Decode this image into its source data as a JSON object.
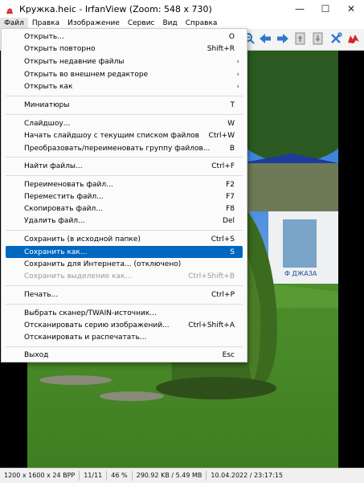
{
  "window": {
    "title": "Кружка.heic - IrfanView (Zoom: 548 x 730)",
    "minimize_glyph": "—",
    "maximize_glyph": "☐",
    "close_glyph": "✕"
  },
  "menubar": [
    "Файл",
    "Правка",
    "Изображение",
    "Сервис",
    "Вид",
    "Справка"
  ],
  "file_menu": {
    "items": [
      {
        "label": "Открыть...",
        "shortcut": "O"
      },
      {
        "label": "Открыть повторно",
        "shortcut": "Shift+R"
      },
      {
        "label": "Открыть недавние файлы",
        "submenu": true
      },
      {
        "label": "Открыть во внешнем редакторе",
        "submenu": true
      },
      {
        "label": "Открыть как",
        "submenu": true
      },
      {
        "label": "Миниатюры",
        "shortcut": "T"
      },
      {
        "label": "Слайдшоу...",
        "shortcut": "W"
      },
      {
        "label": "Начать слайдшоу с текущим списком файлов",
        "shortcut": "Ctrl+W"
      },
      {
        "label": "Преобразовать/переименовать группу файлов...",
        "shortcut": "B"
      },
      {
        "label": "Найти файлы...",
        "shortcut": "Ctrl+F"
      },
      {
        "label": "Переименовать файл...",
        "shortcut": "F2"
      },
      {
        "label": "Переместить файл...",
        "shortcut": "F7"
      },
      {
        "label": "Скопировать файл...",
        "shortcut": "F8"
      },
      {
        "label": "Удалить файл...",
        "shortcut": "Del"
      },
      {
        "label": "Сохранить (в исходной папке)",
        "shortcut": "Ctrl+S"
      },
      {
        "label": "Сохранить как...",
        "shortcut": "S",
        "selected": true
      },
      {
        "label": "Сохранить для Интернета... (отключено)"
      },
      {
        "label": "Сохранить выделение как...",
        "shortcut": "Ctrl+Shift+B",
        "disabled": true
      },
      {
        "label": "Печать...",
        "shortcut": "Ctrl+P"
      },
      {
        "label": "Выбрать сканер/TWAIN-источник..."
      },
      {
        "label": "Отсканировать серию изображений...",
        "shortcut": "Ctrl+Shift+A"
      },
      {
        "label": "Отсканировать и распечатать..."
      },
      {
        "label": "Выход",
        "shortcut": "Esc"
      }
    ]
  },
  "photo": {
    "sign_text": "Ф ДЖАЗА"
  },
  "statusbar": [
    "1200 x 1600 x 24 BPP",
    "11/11",
    "46 %",
    "290.92 KB / 5.49 MB",
    "10.04.2022 / 23:17:15"
  ],
  "colors": {
    "menu_highlight": "#0067c0",
    "toolbar_blue": "#2f77d1",
    "toolbar_red": "#d62828"
  }
}
